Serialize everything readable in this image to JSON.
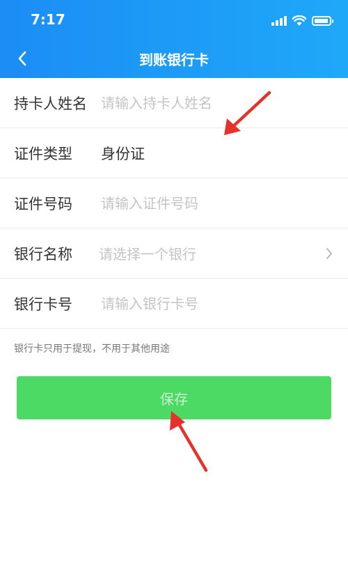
{
  "status_bar": {
    "time": "7:17"
  },
  "nav": {
    "title": "到账银行卡"
  },
  "form": {
    "cardholder": {
      "label": "持卡人姓名",
      "placeholder": "请输入持卡人姓名"
    },
    "id_type": {
      "label": "证件类型",
      "value": "身份证"
    },
    "id_number": {
      "label": "证件号码",
      "placeholder": "请输入证件号码"
    },
    "bank_name": {
      "label": "银行名称",
      "placeholder": "请选择一个银行"
    },
    "card_number": {
      "label": "银行卡号",
      "placeholder": "请输入银行卡号"
    }
  },
  "note": "银行卡只用于提现，不用于其他用途",
  "save_label": "保存",
  "colors": {
    "header": "#1b8df5",
    "save_button": "#4cd964",
    "annotation_arrow": "#e8302a"
  }
}
